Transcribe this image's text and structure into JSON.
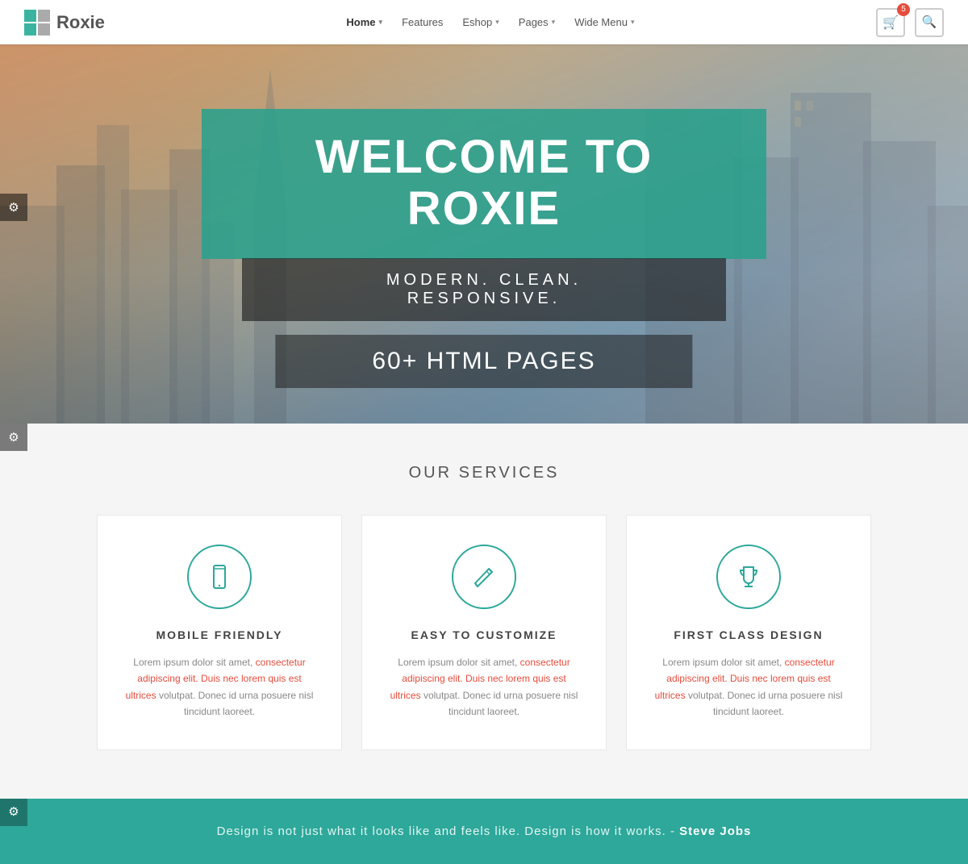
{
  "header": {
    "logo_text": "Roxie",
    "nav": [
      {
        "label": "Home",
        "has_dropdown": true,
        "active": true
      },
      {
        "label": "Features",
        "has_dropdown": false,
        "active": false
      },
      {
        "label": "Eshop",
        "has_dropdown": true,
        "active": false
      },
      {
        "label": "Pages",
        "has_dropdown": true,
        "active": false
      },
      {
        "label": "Wide Menu",
        "has_dropdown": true,
        "active": false
      }
    ],
    "cart_count": "5",
    "cart_aria": "shopping cart",
    "search_aria": "search"
  },
  "hero": {
    "title": "WELCOME TO ROXIE",
    "subtitle": "MODERN. CLEAN. RESPONSIVE.",
    "pages_text": "60+ HTML PAGES",
    "settings_aria": "hero settings"
  },
  "services": {
    "section_title": "OUR SERVICES",
    "settings_aria": "services settings",
    "cards": [
      {
        "icon": "mobile",
        "title": "MOBILE FRIENDLY",
        "text": "Lorem ipsum dolor sit amet, consectetur adipiscing elit. Duis nec lorem quis est ultrices volutpat. Donec id urna posuere nisl tincidunt laoreet."
      },
      {
        "icon": "pencil",
        "title": "EASY TO CUSTOMIZE",
        "text": "Lorem ipsum dolor sit amet, consectetur adipiscing elit. Duis nec lorem quis est ultrices volutpat. Donec id urna posuere nisl tincidunt laoreet."
      },
      {
        "icon": "trophy",
        "title": "FIRST CLASS DESIGN",
        "text": "Lorem ipsum dolor sit amet, consectetur adipiscing elit. Duis nec lorem quis est ultrices volutpat. Donec id urna posuere nisl tincidunt laoreet."
      }
    ]
  },
  "quote": {
    "settings_aria": "quote settings",
    "text": "Design is not just what it looks like and feels like. Design is how it works.",
    "attribution": " - ",
    "author": "Steve Jobs"
  },
  "colors": {
    "teal": "#2da89a",
    "red": "#e74c3c",
    "dark_overlay": "rgba(30,30,30,0.65)"
  }
}
